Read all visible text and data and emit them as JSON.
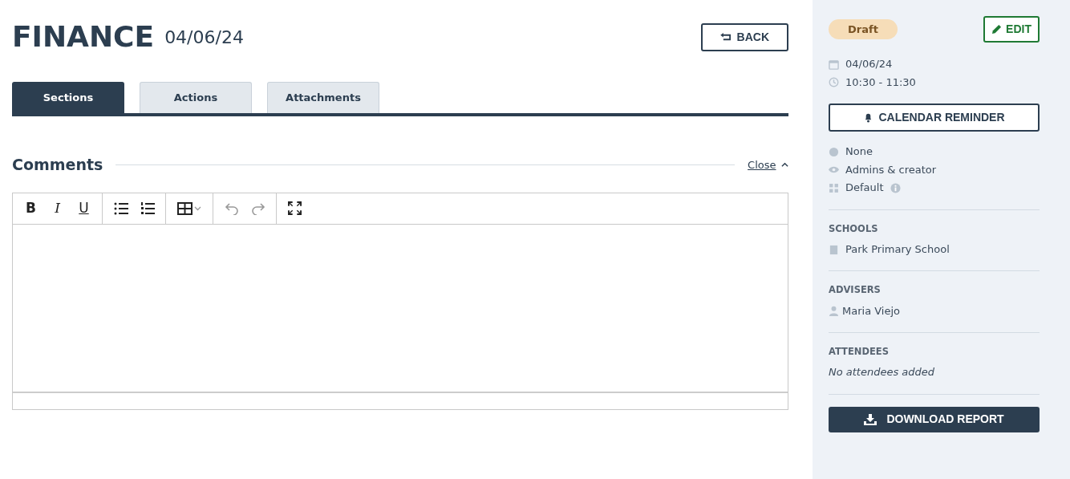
{
  "header": {
    "title": "FINANCE",
    "date": "04/06/24",
    "back_button": "BACK"
  },
  "tabs": [
    {
      "label": "Sections",
      "selected": true
    },
    {
      "label": "Actions",
      "selected": false
    },
    {
      "label": "Attachments",
      "selected": false
    }
  ],
  "comments": {
    "title": "Comments",
    "toggle": "Close",
    "expanded": true
  },
  "editor": {
    "toolbar": [
      {
        "items": [
          {
            "kind": "bold",
            "label": "B",
            "disabled": false
          },
          {
            "kind": "italic",
            "label": "I",
            "disabled": false
          },
          {
            "kind": "underline",
            "label": "U",
            "disabled": false
          }
        ]
      },
      {
        "items": [
          {
            "kind": "bullet-list",
            "disabled": false
          },
          {
            "kind": "numbered-list",
            "disabled": false
          }
        ]
      },
      {
        "items": [
          {
            "kind": "table",
            "disabled": false
          }
        ]
      },
      {
        "items": [
          {
            "kind": "undo",
            "disabled": true
          },
          {
            "kind": "redo",
            "disabled": true
          }
        ]
      },
      {
        "items": [
          {
            "kind": "fullscreen",
            "disabled": false
          }
        ]
      }
    ]
  },
  "sidebar": {
    "status": "Draft",
    "edit_button": "EDIT",
    "date": "04/06/24",
    "time": "10:30 - 11:30",
    "reminder_button": "CALENDAR REMINDER",
    "details": [
      {
        "kind": "cost",
        "text": "None",
        "info": false
      },
      {
        "kind": "visibility",
        "text": "Admins & creator",
        "info": false
      },
      {
        "kind": "template",
        "text": "Default",
        "info": true
      }
    ],
    "sections": [
      {
        "heading": "SCHOOLS",
        "items": [
          {
            "kind": "school",
            "text": "Park Primary School"
          }
        ]
      },
      {
        "heading": "ADVISERS",
        "items": [
          {
            "kind": "person",
            "text": "Maria Viejo"
          }
        ]
      },
      {
        "heading": "ATTENDEES",
        "empty_text": "No attendees added"
      }
    ],
    "download_button": "DOWNLOAD REPORT"
  }
}
